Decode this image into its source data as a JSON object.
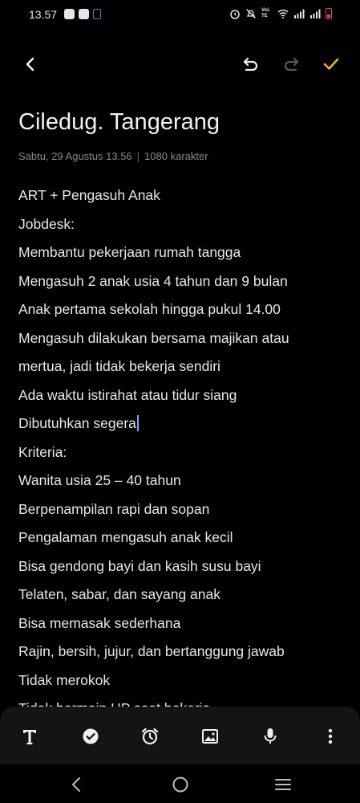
{
  "status_bar": {
    "time": "13.57",
    "icons_left": [
      "app-notification-icon",
      "bag-icon",
      "sim-icon"
    ],
    "icons_right": [
      "alarm-icon",
      "mute-icon",
      "volte-icon",
      "wifi-icon",
      "signal-icon",
      "signal-icon-2",
      "battery-icon"
    ],
    "volte_label": "VoLTE",
    "battery_color": "#e05050"
  },
  "toolbar": {
    "icons": [
      "back-arrow-icon",
      "undo-icon",
      "redo-icon",
      "check-icon"
    ],
    "accent_color": "#f0b429"
  },
  "note": {
    "title": "Ciledug. Tangerang",
    "date": "Sabtu, 29 Agustus 13.56",
    "separator": "|",
    "char_count": "1080 karakter",
    "lines": [
      "ART + Pengasuh Anak",
      "Jobdesk:",
      "Membantu pekerjaan rumah tangga",
      "Mengasuh 2 anak usia 4 tahun dan 9 bulan",
      "Anak pertama sekolah hingga pukul 14.00",
      "Mengasuh dilakukan bersama majikan atau",
      "mertua, jadi tidak bekerja sendiri",
      "Ada waktu istirahat atau tidur siang",
      "Dibutuhkan segera",
      "Kriteria:",
      "Wanita usia 25 – 40 tahun",
      "Berpenampilan rapi dan sopan",
      "Pengalaman mengasuh anak kecil",
      "Bisa gendong bayi dan kasih susu bayi",
      "Telaten, sabar, dan sayang anak",
      "Bisa memasak sederhana",
      "Rajin, bersih, jujur, dan bertanggung jawab",
      "Tidak merokok",
      "Tidak bermain HP saat bekerja"
    ]
  },
  "bottom_toolbar": {
    "icons": [
      "text-format-icon",
      "checklist-icon",
      "alarm-clock-icon",
      "image-icon",
      "microphone-icon",
      "more-vertical-icon"
    ]
  },
  "nav_bar": {
    "icons": [
      "nav-back-icon",
      "nav-home-icon",
      "nav-recents-icon"
    ]
  }
}
